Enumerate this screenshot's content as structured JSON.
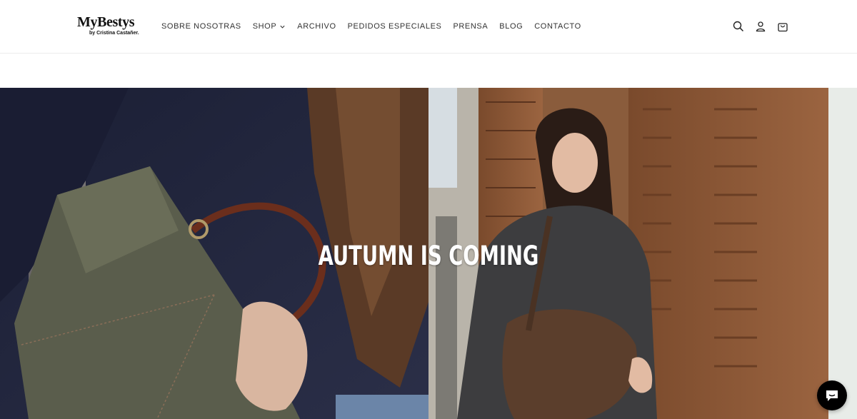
{
  "brand": {
    "name": "MyBestys",
    "tagline": "by Cristina Castañer."
  },
  "nav": {
    "items": [
      {
        "label": "SOBRE NOSOTRAS"
      },
      {
        "label": "SHOP"
      },
      {
        "label": "ARCHIVO"
      },
      {
        "label": "PEDIDOS ESPECIALES"
      },
      {
        "label": "PRENSA"
      },
      {
        "label": "BLOG"
      },
      {
        "label": "CONTACTO"
      }
    ]
  },
  "icons": {
    "search": "search-icon",
    "account": "user-icon",
    "cart": "bag-icon",
    "chat": "chat-icon",
    "shop_dropdown": "chevron-down-icon"
  },
  "hero": {
    "heading": "AUTUMN IS COMING"
  },
  "colors": {
    "header_bg": "#ffffff",
    "nav_text": "#333333",
    "hero_text": "#ffffff",
    "chat_button": "#000000"
  }
}
